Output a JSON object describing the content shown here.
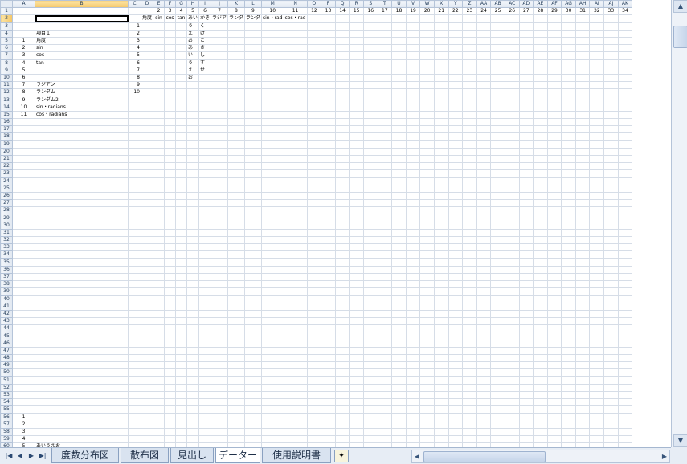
{
  "sheet": {
    "columns": [
      "A",
      "B",
      "C",
      "D",
      "E",
      "F",
      "G",
      "H",
      "I",
      "J",
      "K",
      "L",
      "M",
      "N",
      "O",
      "P",
      "Q",
      "R",
      "S",
      "T",
      "U",
      "V",
      "W",
      "X",
      "Y",
      "Z",
      "AA",
      "AB",
      "AC",
      "AD",
      "AE",
      "AF",
      "AG",
      "AH",
      "AI",
      "AJ",
      "AK"
    ],
    "row_start": 1,
    "row_count": 61,
    "active_row": 2,
    "active_col": "B"
  },
  "cells": {
    "1": {
      "E": "2",
      "F": "3",
      "G": "4",
      "H": "5",
      "I": "6",
      "J": "7",
      "K": "8",
      "L": "9",
      "M": "10",
      "N": "11",
      "O": "12",
      "P": "13",
      "Q": "14",
      "R": "15",
      "S": "16",
      "T": "17",
      "U": "18",
      "V": "19",
      "W": "20",
      "X": "21",
      "Y": "22",
      "Z": "23",
      "AA": "24",
      "AB": "25",
      "AC": "26",
      "AD": "27",
      "AE": "28",
      "AF": "29",
      "AG": "30",
      "AH": "31",
      "AI": "32",
      "AJ": "33",
      "AK": "34"
    },
    "2": {
      "D": "角度",
      "E": "sin",
      "F": "cos",
      "G": "tan",
      "H": "あい",
      "I": "かき",
      "J": "ラジア",
      "K": "ランダ",
      "L": "ランダ",
      "M": "sin・rad",
      "N": "cos・rad"
    },
    "3": {
      "C": "1",
      "H": "う",
      "I": "く"
    },
    "4": {
      "B": "項目１",
      "C": "2",
      "H": "え",
      "I": "け"
    },
    "5": {
      "A": "1",
      "B": "角度",
      "C": "3",
      "H": "お",
      "I": "こ"
    },
    "6": {
      "A": "2",
      "B": "sin",
      "C": "4",
      "H": "あ",
      "I": "さ"
    },
    "7": {
      "A": "3",
      "B": "cos",
      "C": "5",
      "H": "い",
      "I": "し"
    },
    "8": {
      "A": "4",
      "B": "tan",
      "C": "6",
      "H": "う",
      "I": "す"
    },
    "9": {
      "A": "5",
      "C": "7",
      "H": "え",
      "I": "せ"
    },
    "10": {
      "A": "6",
      "C": "8",
      "H": "お"
    },
    "11": {
      "A": "7",
      "B": "ラジアン",
      "C": "9"
    },
    "12": {
      "A": "8",
      "B": "ランダム",
      "C": "10"
    },
    "13": {
      "A": "9",
      "B": "ランダム2"
    },
    "14": {
      "A": "10",
      "B": "sin・radians"
    },
    "15": {
      "A": "11",
      "B": "cos・radians"
    },
    "56": {
      "A": "1"
    },
    "57": {
      "A": "2"
    },
    "58": {
      "A": "3"
    },
    "59": {
      "A": "4"
    },
    "60": {
      "A": "5",
      "B": "あいうえお"
    },
    "61": {
      "A": "6",
      "B": "かきくけこさしすせ"
    }
  },
  "tabs": [
    {
      "label": "度数分布図",
      "active": false
    },
    {
      "label": "散布図",
      "active": false
    },
    {
      "label": "見出し",
      "active": false
    },
    {
      "label": "データー",
      "active": true
    },
    {
      "label": "使用説明書",
      "active": false
    }
  ],
  "nav_icons": [
    "first-sheet-icon",
    "prev-sheet-icon",
    "next-sheet-icon",
    "last-sheet-icon"
  ]
}
